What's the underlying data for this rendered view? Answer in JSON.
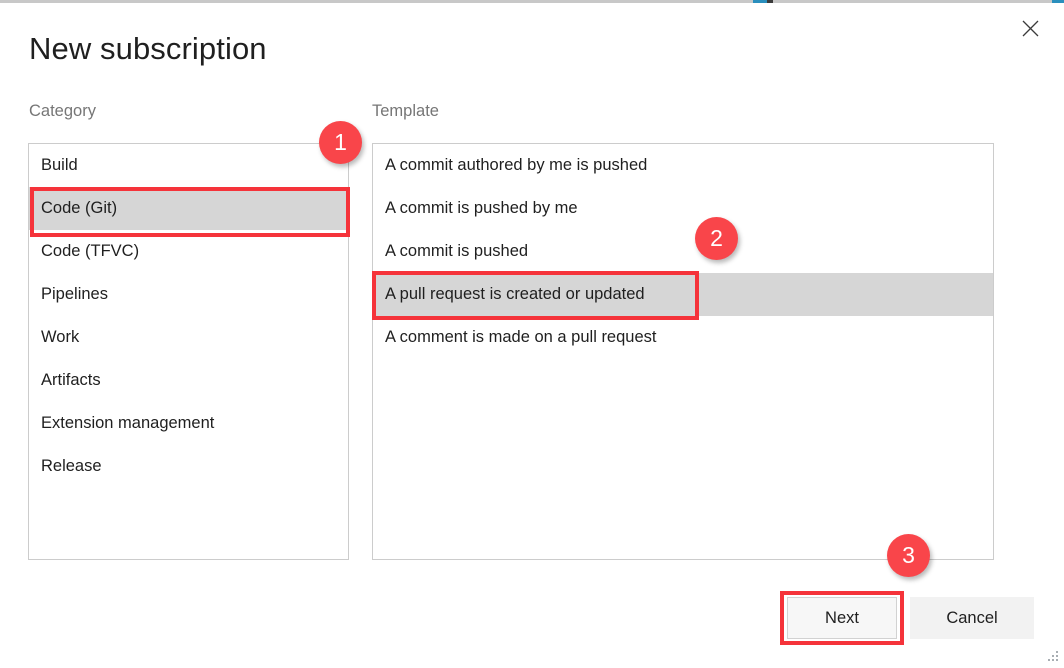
{
  "window": {
    "title": "New subscription",
    "close_label": "×"
  },
  "category": {
    "label": "Category",
    "items": [
      {
        "label": "Build",
        "selected": false
      },
      {
        "label": "Code (Git)",
        "selected": true
      },
      {
        "label": "Code (TFVC)",
        "selected": false
      },
      {
        "label": "Pipelines",
        "selected": false
      },
      {
        "label": "Work",
        "selected": false
      },
      {
        "label": "Artifacts",
        "selected": false
      },
      {
        "label": "Extension management",
        "selected": false
      },
      {
        "label": "Release",
        "selected": false
      }
    ]
  },
  "template": {
    "label": "Template",
    "items": [
      {
        "label": "A commit authored by me is pushed",
        "selected": false
      },
      {
        "label": "A commit is pushed by me",
        "selected": false
      },
      {
        "label": "A commit is pushed",
        "selected": false
      },
      {
        "label": "A pull request is created or updated",
        "selected": true
      },
      {
        "label": "A comment is made on a pull request",
        "selected": false
      }
    ]
  },
  "footer": {
    "next_label": "Next",
    "cancel_label": "Cancel"
  },
  "annotations": {
    "badges": [
      {
        "number": "1"
      },
      {
        "number": "2"
      },
      {
        "number": "3"
      }
    ],
    "accent_color": "#f5333a",
    "badge_color": "#f9454a"
  }
}
